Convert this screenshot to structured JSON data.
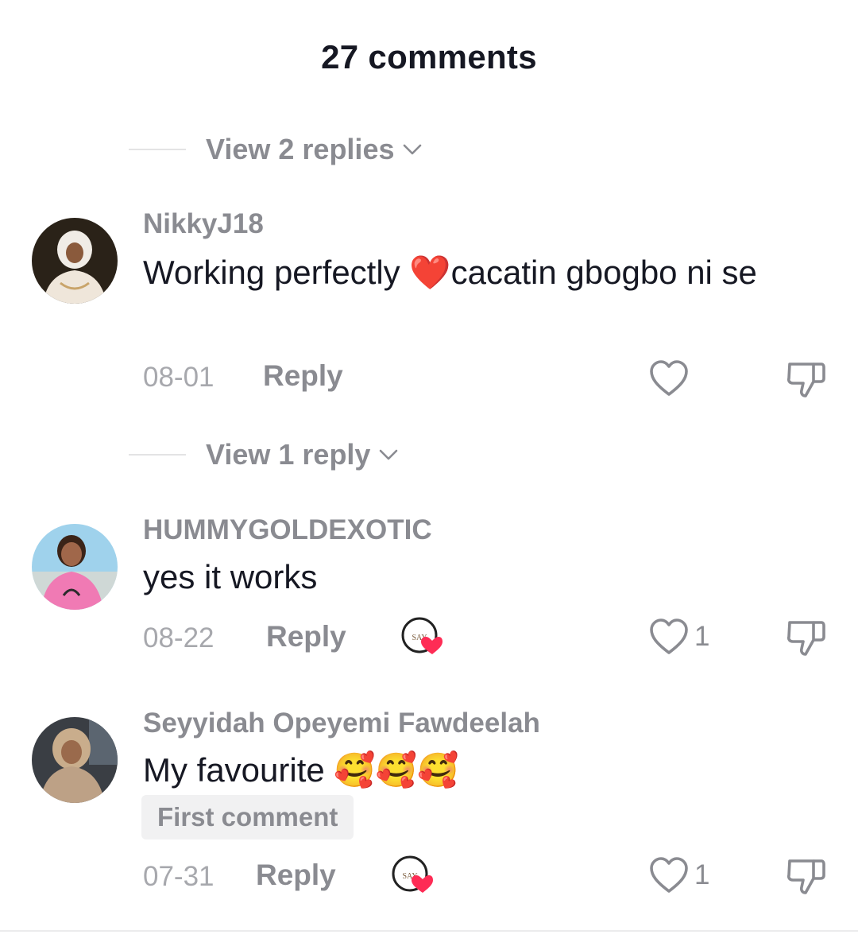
{
  "header": {
    "title": "27 comments"
  },
  "thread_toggles": [
    {
      "label": "View 2 replies"
    },
    {
      "label": "View 1 reply"
    }
  ],
  "comments": [
    {
      "username": "NikkyJ18",
      "text": "Working perfectly ❤️cacatin gbogbo ni se",
      "date": "08-01",
      "reply_label": "Reply",
      "likes": "",
      "creator_liked": false
    },
    {
      "username": "HUMMYGOLDEXOTIC",
      "text": "yes it works",
      "date": "08-22",
      "reply_label": "Reply",
      "likes": "1",
      "creator_liked": true
    },
    {
      "username": "Seyyidah Opeyemi Fawdeelah",
      "text": "My favourite 🥰🥰🥰",
      "badge": "First comment",
      "date": "07-31",
      "reply_label": "Reply",
      "likes": "1",
      "creator_liked": true
    }
  ],
  "colors": {
    "text_primary": "#161823",
    "text_secondary": "#8a8b91",
    "accent_heart": "#fe2c55"
  },
  "icons": [
    "chevron-down-icon",
    "heart-outline-icon",
    "dislike-icon",
    "creator-liked-icon"
  ]
}
